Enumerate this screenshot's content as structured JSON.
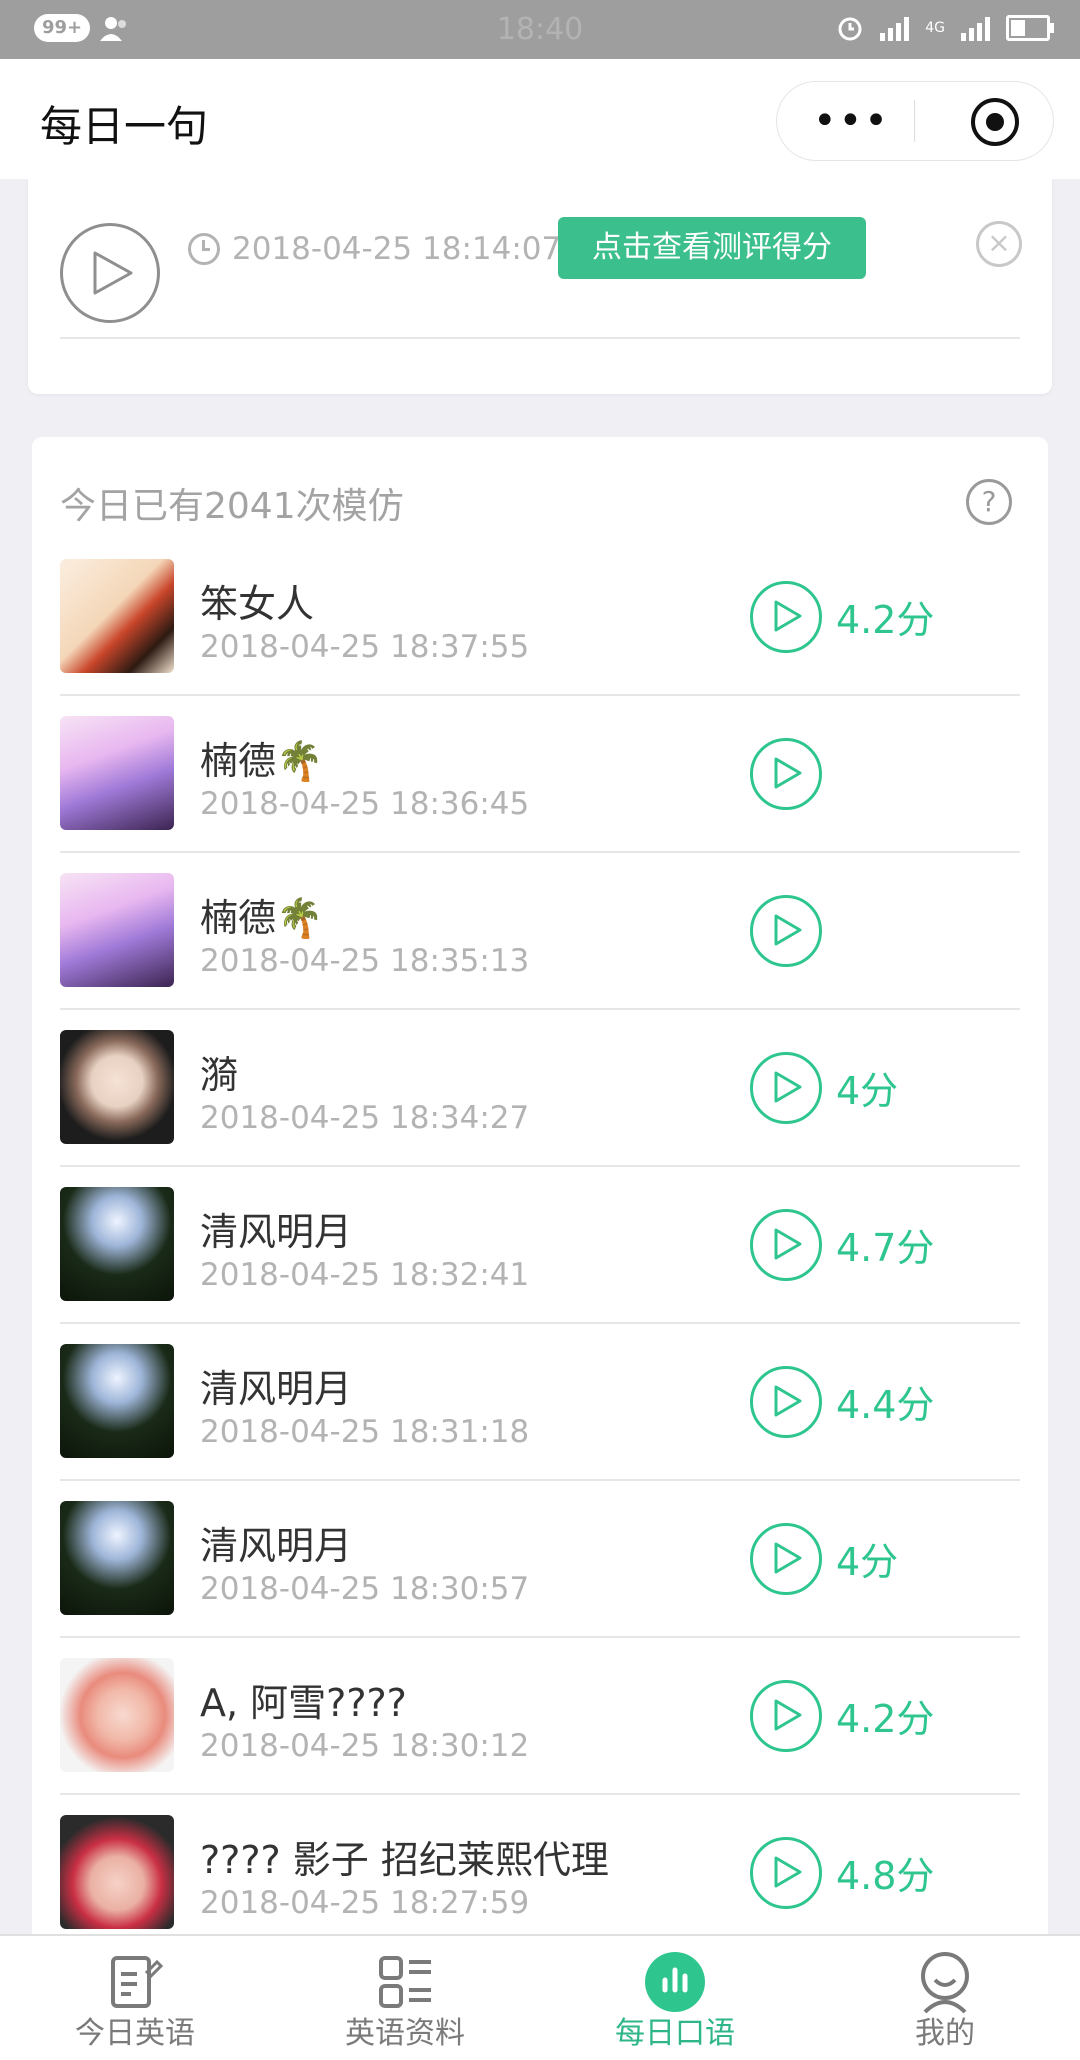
{
  "status_bar": {
    "notifications": "99+",
    "time": "18:40",
    "network": "4G"
  },
  "nav": {
    "title": "每日一句",
    "more_label": "•••"
  },
  "my_recording": {
    "time": "2018-04-25 18:14:07",
    "score_button": "点击查看测评得分",
    "close_label": "×"
  },
  "imitations": {
    "header": "今日已有2041次模仿",
    "help_label": "?",
    "items": [
      {
        "name": "笨女人",
        "time": "2018-04-25 18:37:55",
        "score": "4.2分"
      },
      {
        "name": "楠德🌴",
        "time": "2018-04-25 18:36:45",
        "score": ""
      },
      {
        "name": "楠德🌴",
        "time": "2018-04-25 18:35:13",
        "score": ""
      },
      {
        "name": "漪",
        "time": "2018-04-25 18:34:27",
        "score": "4分"
      },
      {
        "name": "清风明月",
        "time": "2018-04-25 18:32:41",
        "score": "4.7分"
      },
      {
        "name": "清风明月",
        "time": "2018-04-25 18:31:18",
        "score": "4.4分"
      },
      {
        "name": "清风明月",
        "time": "2018-04-25 18:30:57",
        "score": "4分"
      },
      {
        "name": "A, 阿雪????",
        "time": "2018-04-25 18:30:12",
        "score": "4.2分"
      },
      {
        "name": "???? 影子 招纪莱熙代理",
        "time": "2018-04-25 18:27:59",
        "score": "4.8分"
      }
    ]
  },
  "tabs": [
    {
      "label": "今日英语",
      "icon": "document-icon",
      "active": false
    },
    {
      "label": "英语资料",
      "icon": "list-icon",
      "active": false
    },
    {
      "label": "每日口语",
      "icon": "chart-icon",
      "active": true
    },
    {
      "label": "我的",
      "icon": "user-icon",
      "active": false
    }
  ],
  "colors": {
    "accent": "#2ec68e",
    "button": "#3bbf8c",
    "statusbar": "#9e9e9e"
  }
}
